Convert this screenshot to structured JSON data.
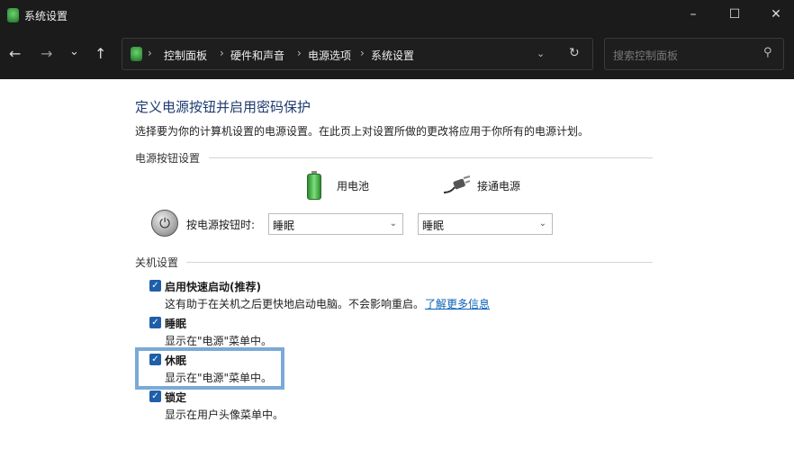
{
  "window": {
    "title": "系统设置",
    "minimize": "–",
    "maximize": "☐",
    "close": "✕"
  },
  "toolbar": {
    "back": "←",
    "forward": "→",
    "recent": "⌄",
    "up": "↑",
    "breadcrumb": [
      "控制面板",
      "硬件和声音",
      "电源选项",
      "系统设置"
    ],
    "search_placeholder": "搜索控制面板"
  },
  "main": {
    "title": "定义电源按钮并启用密码保护",
    "description": "选择要为你的计算机设置的电源设置。在此页上对设置所做的更改将应用于你所有的电源计划。",
    "power_section": {
      "label": "电源按钮设置",
      "battery_label": "用电池",
      "plugged_label": "接通电源",
      "row_label": "按电源按钮时:",
      "battery_value": "睡眠",
      "plugged_value": "睡眠"
    },
    "shutdown_section": {
      "label": "关机设置",
      "items": [
        {
          "label": "启用快速启动(推荐)",
          "desc": "这有助于在关机之后更快地启动电脑。不会影响重启。",
          "link": "了解更多信息",
          "checked": true
        },
        {
          "label": "睡眠",
          "desc": "显示在\"电源\"菜单中。",
          "checked": true
        },
        {
          "label": "休眠",
          "desc": "显示在\"电源\"菜单中。",
          "checked": true,
          "highlighted": true
        },
        {
          "label": "锁定",
          "desc": "显示在用户头像菜单中。",
          "checked": true
        }
      ]
    }
  }
}
